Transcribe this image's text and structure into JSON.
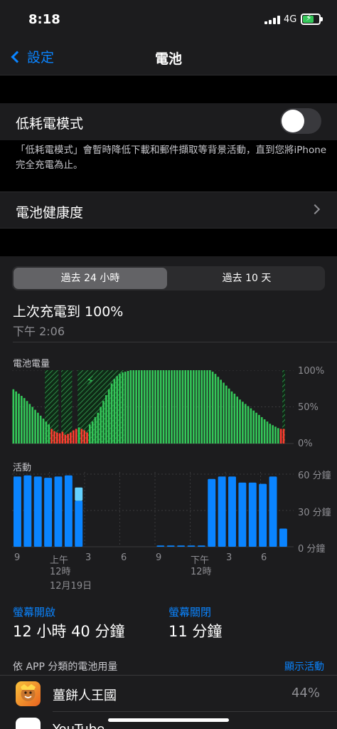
{
  "status_bar": {
    "time": "8:18",
    "network": "4G",
    "battery_level": 0.7
  },
  "nav": {
    "back_label": "設定",
    "title": "電池"
  },
  "low_power": {
    "label": "低耗電模式",
    "enabled": false,
    "footnote": "「低耗電模式」會暫時降低下載和郵件擷取等背景活動，直到您將iPhone完全充電為止。"
  },
  "battery_health": {
    "label": "電池健康度"
  },
  "range_tabs": [
    "過去 24 小時",
    "過去 10 天"
  ],
  "last_charge": {
    "title": "上次充電到 100%",
    "time": "下午 2:06"
  },
  "battery_chart": {
    "label": "電池電量",
    "y_ticks": [
      "100%",
      "50%",
      "0%"
    ]
  },
  "activity_chart": {
    "label": "活動",
    "y_ticks": [
      "60 分鐘",
      "30 分鐘",
      "0 分鐘"
    ],
    "x_ticks": [
      "9",
      "上午",
      "12時",
      "12月19日",
      "3",
      "6",
      "9",
      "下午",
      "12時",
      "3",
      "6"
    ]
  },
  "screen_time": {
    "on_label": "螢幕開啟",
    "on_value": "12 小時 40 分鐘",
    "off_label": "螢幕關閉",
    "off_value": "11 分鐘"
  },
  "app_usage": {
    "header": "依 APP 分類的電池用量",
    "action": "顯示活動",
    "apps": [
      {
        "name": "薑餅人王國",
        "percent": "44%",
        "icon": "cookie-run-icon"
      },
      {
        "name": "YouTube",
        "percent": "",
        "icon": "youtube-icon"
      }
    ]
  },
  "chart_data": [
    {
      "type": "bar",
      "title": "電池電量",
      "ylim": [
        0,
        100
      ],
      "y_ticks": [
        "0%",
        "50%",
        "100%"
      ],
      "values": [
        74,
        71,
        68,
        65,
        62,
        58,
        54,
        50,
        46,
        42,
        38,
        34,
        30,
        26,
        20,
        17,
        15,
        14,
        16,
        12,
        13,
        15,
        18,
        20,
        22,
        20,
        18,
        15,
        26,
        30,
        36,
        42,
        50,
        58,
        66,
        74,
        82,
        88,
        92,
        95,
        97,
        98,
        99,
        100,
        100,
        100,
        100,
        100,
        100,
        100,
        100,
        100,
        100,
        100,
        100,
        100,
        100,
        100,
        100,
        100,
        100,
        100,
        100,
        100,
        100,
        100,
        100,
        100,
        100,
        100,
        100,
        100,
        100,
        98,
        95,
        91,
        87,
        83,
        79,
        75,
        71,
        68,
        64,
        60,
        57,
        54,
        51,
        48,
        45,
        42,
        39,
        36,
        33,
        30,
        27,
        25,
        23,
        21,
        20,
        20
      ],
      "status": "low values shown in red, charging periods hatched"
    },
    {
      "type": "bar",
      "title": "活動",
      "ylim": [
        0,
        60
      ],
      "y_ticks": [
        "0 分鐘",
        "30 分鐘",
        "60 分鐘"
      ],
      "series": [
        {
          "name": "",
          "values": [
            58,
            59,
            58,
            57,
            58,
            59,
            38,
            0,
            0,
            0,
            0,
            0,
            0,
            0,
            1,
            1,
            1,
            1,
            1,
            56,
            58,
            58,
            53,
            53,
            52,
            58,
            15
          ]
        },
        {
          "name": "",
          "values": [
            0,
            0,
            0,
            0,
            0,
            0,
            11,
            0,
            0,
            0,
            0,
            0,
            0,
            0,
            0,
            0,
            0,
            0,
            0,
            0,
            0,
            0,
            0,
            0,
            0,
            0,
            0
          ]
        }
      ]
    }
  ]
}
